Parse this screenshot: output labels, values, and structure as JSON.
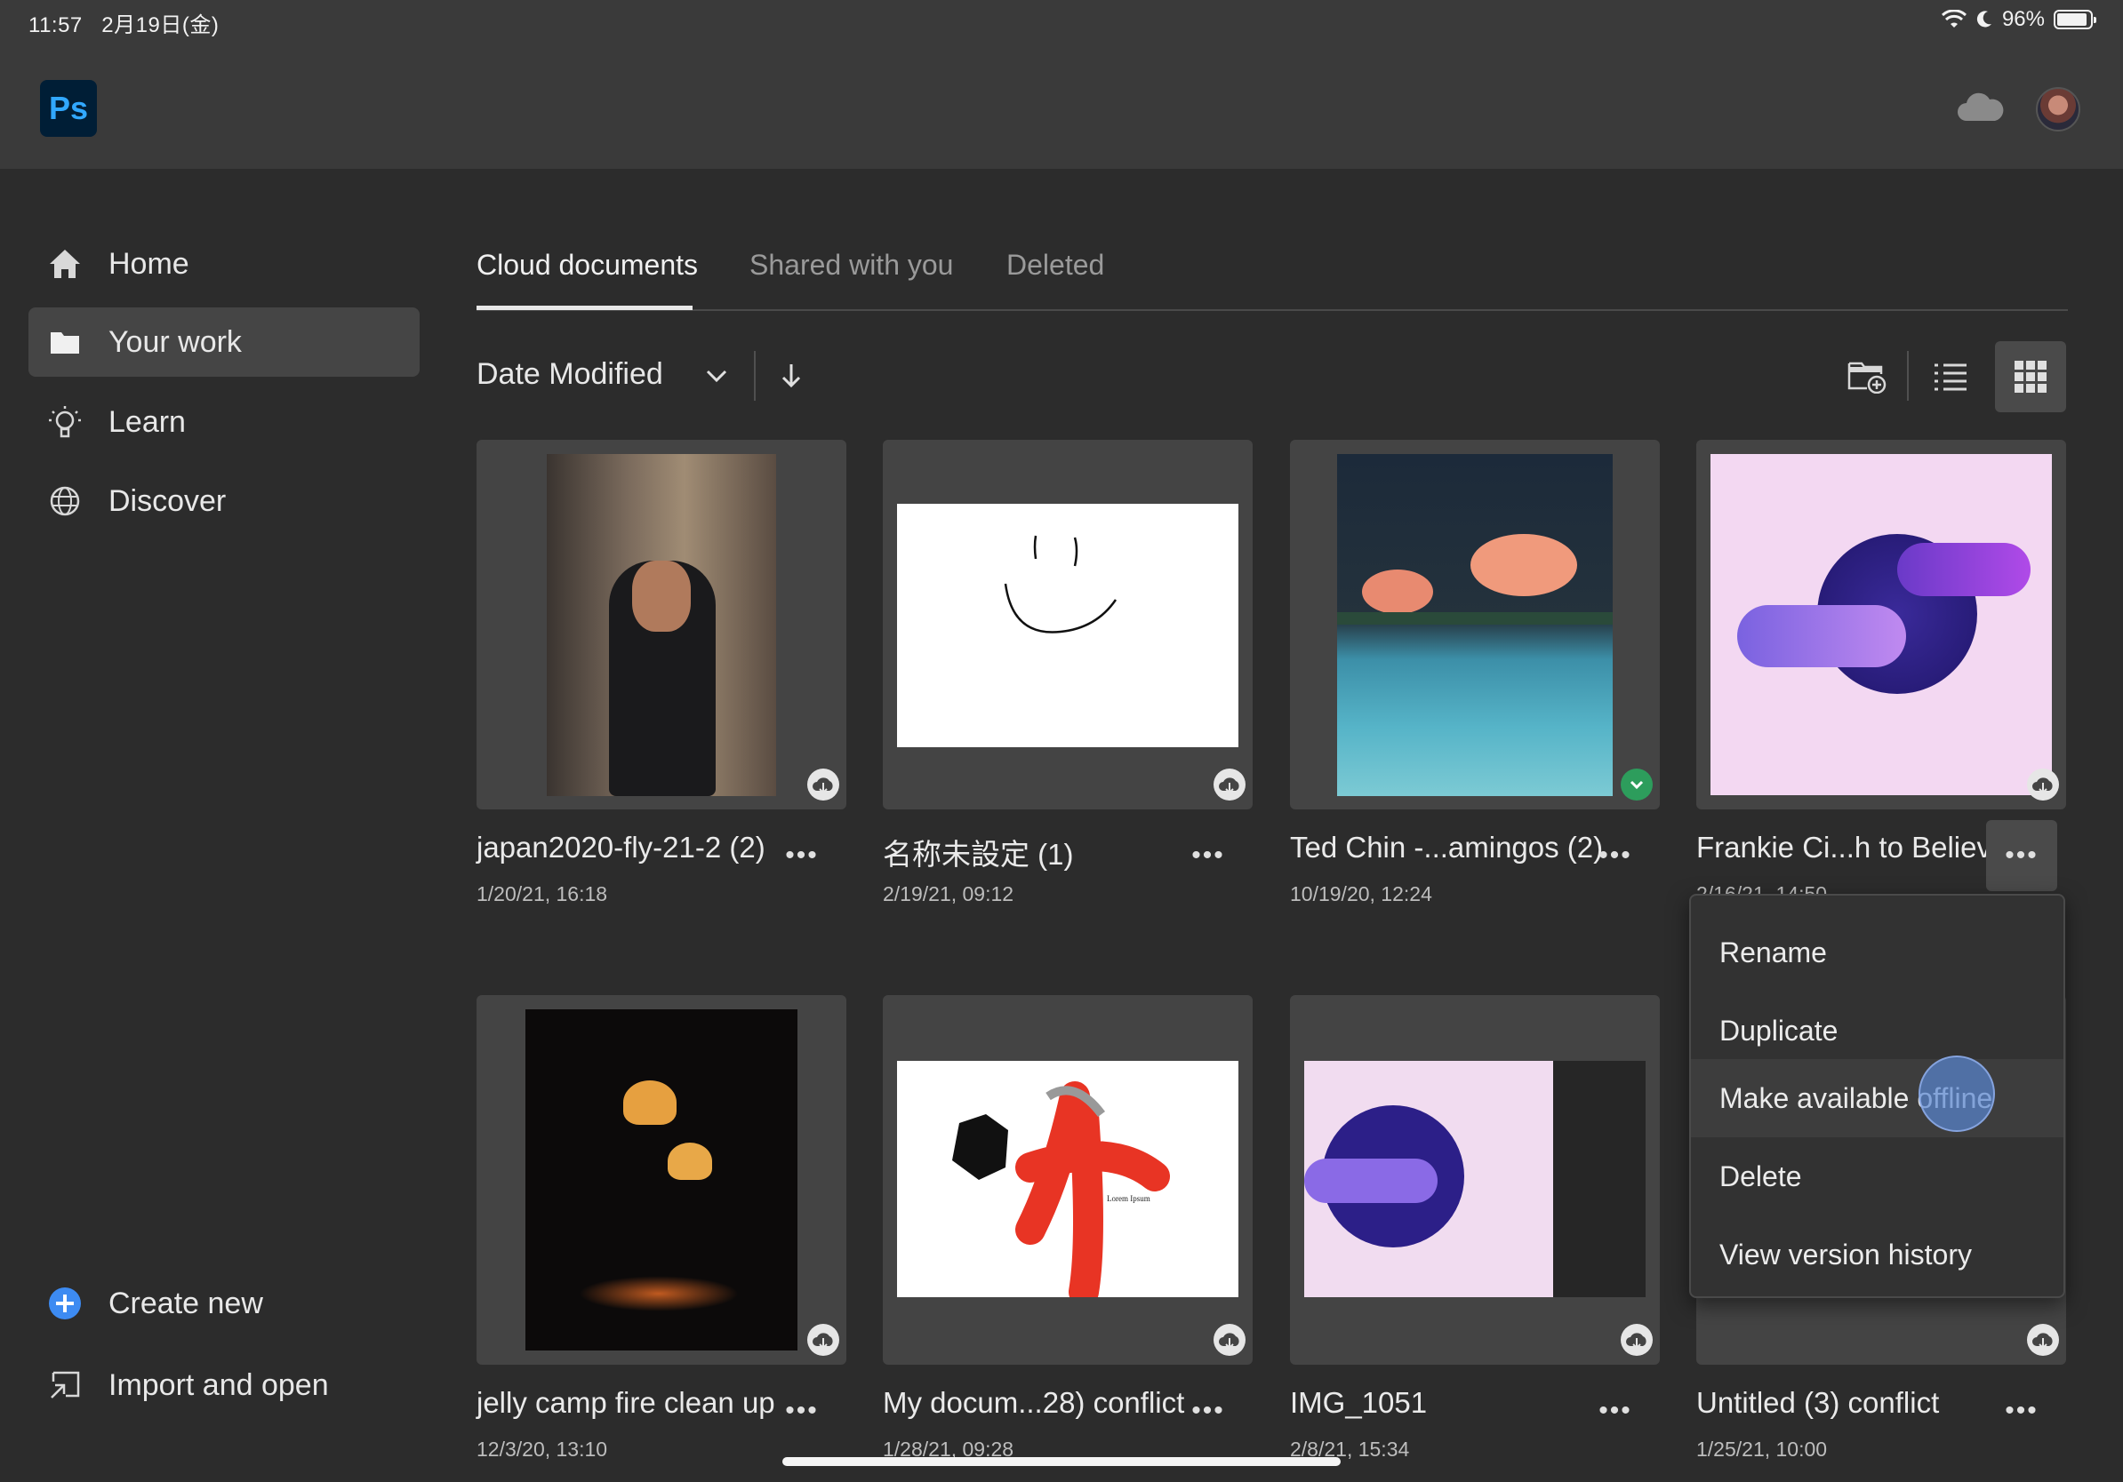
{
  "status_bar": {
    "time": "11:57",
    "date": "2月19日(金)",
    "battery": "96%",
    "battery_level": 0.96
  },
  "app": {
    "logo_text": "Ps"
  },
  "sidebar": {
    "items": [
      {
        "label": "Home",
        "icon": "home-icon"
      },
      {
        "label": "Your work",
        "icon": "folder-icon",
        "active": true
      },
      {
        "label": "Learn",
        "icon": "lightbulb-icon"
      },
      {
        "label": "Discover",
        "icon": "globe-icon"
      }
    ],
    "bottom": [
      {
        "label": "Create new",
        "icon": "plus-circle-icon"
      },
      {
        "label": "Import and open",
        "icon": "import-icon"
      }
    ]
  },
  "tabs": [
    {
      "label": "Cloud documents",
      "active": true
    },
    {
      "label": "Shared with you"
    },
    {
      "label": "Deleted"
    }
  ],
  "toolbar": {
    "sort_label": "Date Modified"
  },
  "documents": [
    {
      "title": "japan2020-fly-21-2 (2)",
      "date": "1/20/21, 16:18",
      "status": "cloud"
    },
    {
      "title": "名称未設定 (1)",
      "date": "2/19/21, 09:12",
      "status": "cloud"
    },
    {
      "title": "Ted Chin -...amingos (2)",
      "date": "10/19/20, 12:24",
      "status": "synced"
    },
    {
      "title": "Frankie Ci...h to Believe",
      "date": "2/16/21, 14:50",
      "status": "cloud"
    },
    {
      "title": "jelly camp fire clean up",
      "date": "12/3/20, 13:10",
      "status": "cloud"
    },
    {
      "title": "My docum...28) conflict",
      "date": "1/28/21, 09:28",
      "status": "cloud"
    },
    {
      "title": "IMG_1051",
      "date": "2/8/21, 15:34",
      "status": "cloud"
    },
    {
      "title": "Untitled (3) conflict",
      "date": "1/25/21, 10:00",
      "status": "cloud"
    }
  ],
  "context_menu": {
    "items": [
      "Rename",
      "Duplicate",
      "Make available offline",
      "Delete",
      "View version history"
    ]
  },
  "thumb_texts": {
    "doc6_small": "Lorem Ipsum"
  },
  "colors": {
    "accent": "#31a8ff",
    "logo_bg": "#001e36",
    "synced": "#2d9d5c",
    "add": "#3d8bf2"
  }
}
